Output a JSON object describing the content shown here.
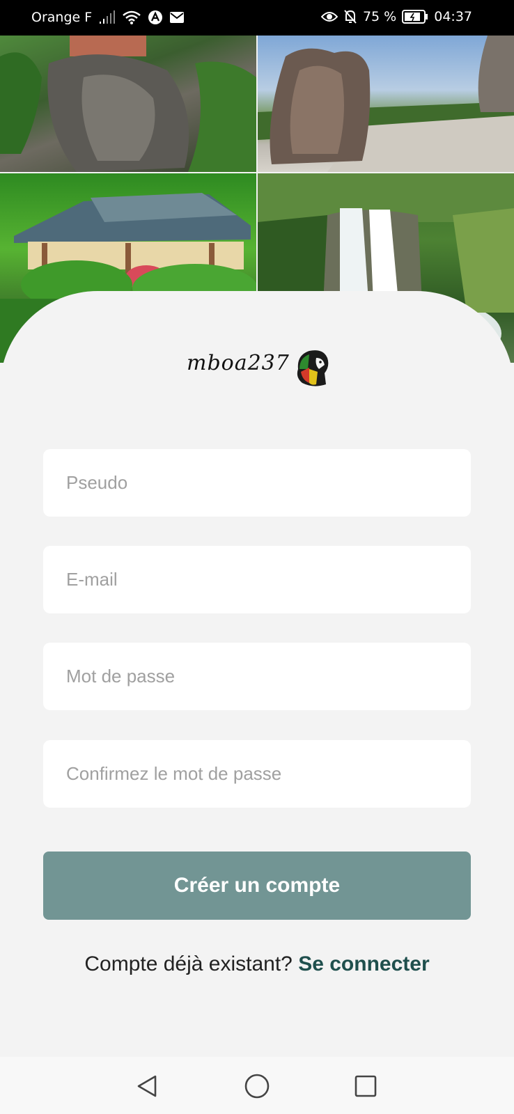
{
  "status_bar": {
    "carrier": "Orange F",
    "battery": "75 %",
    "time": "04:37"
  },
  "logo": {
    "text": "mboa237"
  },
  "form": {
    "pseudo_placeholder": "Pseudo",
    "email_placeholder": "E-mail",
    "password_placeholder": "Mot de passe",
    "confirm_placeholder": "Confirmez le mot de passe",
    "submit_label": "Créer un compte"
  },
  "footer": {
    "question": "Compte déjà existant?",
    "login_link": "Se connecter"
  },
  "colors": {
    "primary_button": "#729594",
    "link": "#1f4f4d",
    "background": "#f3f3f3"
  },
  "icons": {
    "status": [
      "signal-icon",
      "wifi-icon",
      "notification-a-icon",
      "mail-icon",
      "eye-icon",
      "bell-off-icon",
      "battery-icon"
    ],
    "nav": [
      "back-icon",
      "home-icon",
      "recent-apps-icon"
    ]
  }
}
